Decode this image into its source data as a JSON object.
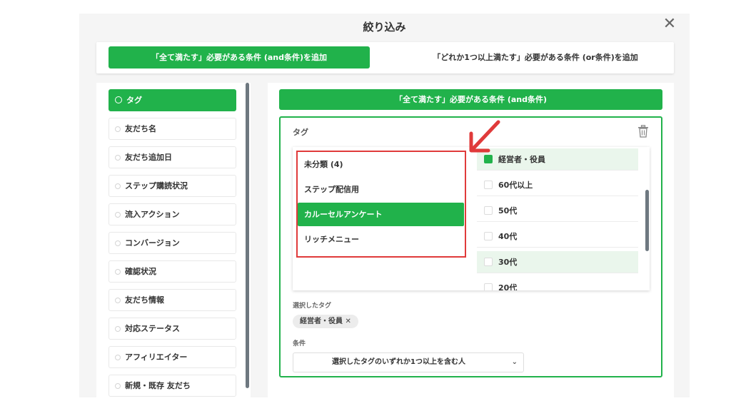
{
  "modal": {
    "title": "絞り込み",
    "close_icon": "close-icon"
  },
  "top_bar": {
    "and_button": "「全て満たす」必要がある条件 (and条件)を追加",
    "or_button": "「どれか1つ以上満たす」必要がある条件 (or条件)を追加"
  },
  "sidebar": {
    "items": [
      {
        "label": "タグ",
        "active": true
      },
      {
        "label": "友だち名"
      },
      {
        "label": "友だち追加日"
      },
      {
        "label": "ステップ購読状況"
      },
      {
        "label": "流入アクション"
      },
      {
        "label": "コンバージョン"
      },
      {
        "label": "確認状況"
      },
      {
        "label": "友だち情報"
      },
      {
        "label": "対応ステータス"
      },
      {
        "label": "アフィリエイター"
      },
      {
        "label": "新規・既存 友だち"
      }
    ]
  },
  "condition": {
    "header": "「全て満たす」必要がある条件 (and条件)",
    "label": "タグ",
    "groups": [
      "未分類 (4)",
      "ステップ配信用",
      "カルーセルアンケート",
      "リッチメニュー"
    ],
    "selected_group": "カルーセルアンケート",
    "tags": [
      {
        "label": "経営者・役員",
        "checked": true
      },
      {
        "label": "60代以上",
        "checked": false
      },
      {
        "label": "50代",
        "checked": false
      },
      {
        "label": "40代",
        "checked": false
      },
      {
        "label": "30代",
        "checked": false
      },
      {
        "label": "20代",
        "checked": false
      }
    ],
    "selected_tags_label": "選択したタグ",
    "selected_chip": "経営者・役員 ✕",
    "condition_label": "条件",
    "condition_value": "選択したタグのいずれか1つ以上を含む人"
  },
  "colors": {
    "accent": "#21b24b",
    "highlight": "#e03a3a"
  }
}
